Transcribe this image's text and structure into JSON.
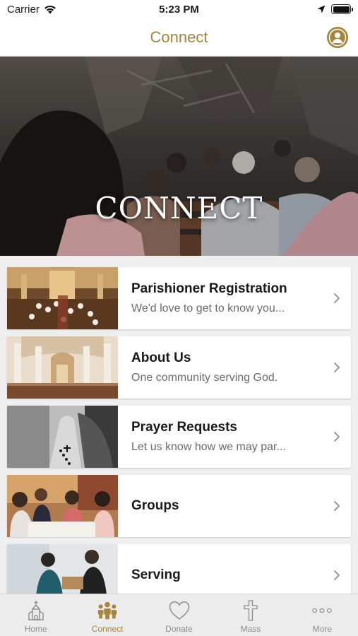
{
  "status_bar": {
    "carrier": "Carrier",
    "time": "5:23 PM"
  },
  "header": {
    "title": "Connect",
    "profile_icon": "person-circle-icon"
  },
  "hero": {
    "title": "CONNECT"
  },
  "items": [
    {
      "title": "Parishioner Registration",
      "subtitle": "We'd love to get to know you...",
      "thumb": "church-interior-crowd"
    },
    {
      "title": "About Us",
      "subtitle": "One community serving God.",
      "thumb": "church-interior-altar"
    },
    {
      "title": "Prayer Requests",
      "subtitle": "Let us know how we may par...",
      "thumb": "praying-hands-rosary"
    },
    {
      "title": "Groups",
      "subtitle": "",
      "thumb": "women-group-table"
    },
    {
      "title": "Serving",
      "subtitle": "",
      "thumb": "volunteers-serving"
    }
  ],
  "tabs": [
    {
      "label": "Home",
      "icon": "church-icon",
      "active": false
    },
    {
      "label": "Connect",
      "icon": "people-icon",
      "active": true
    },
    {
      "label": "Donate",
      "icon": "heart-icon",
      "active": false
    },
    {
      "label": "Mass",
      "icon": "cross-icon",
      "active": false
    },
    {
      "label": "More",
      "icon": "more-dots-icon",
      "active": false
    }
  ],
  "colors": {
    "accent": "#a7853a",
    "inactive": "#8e8e8e",
    "list_background": "#efefef"
  }
}
